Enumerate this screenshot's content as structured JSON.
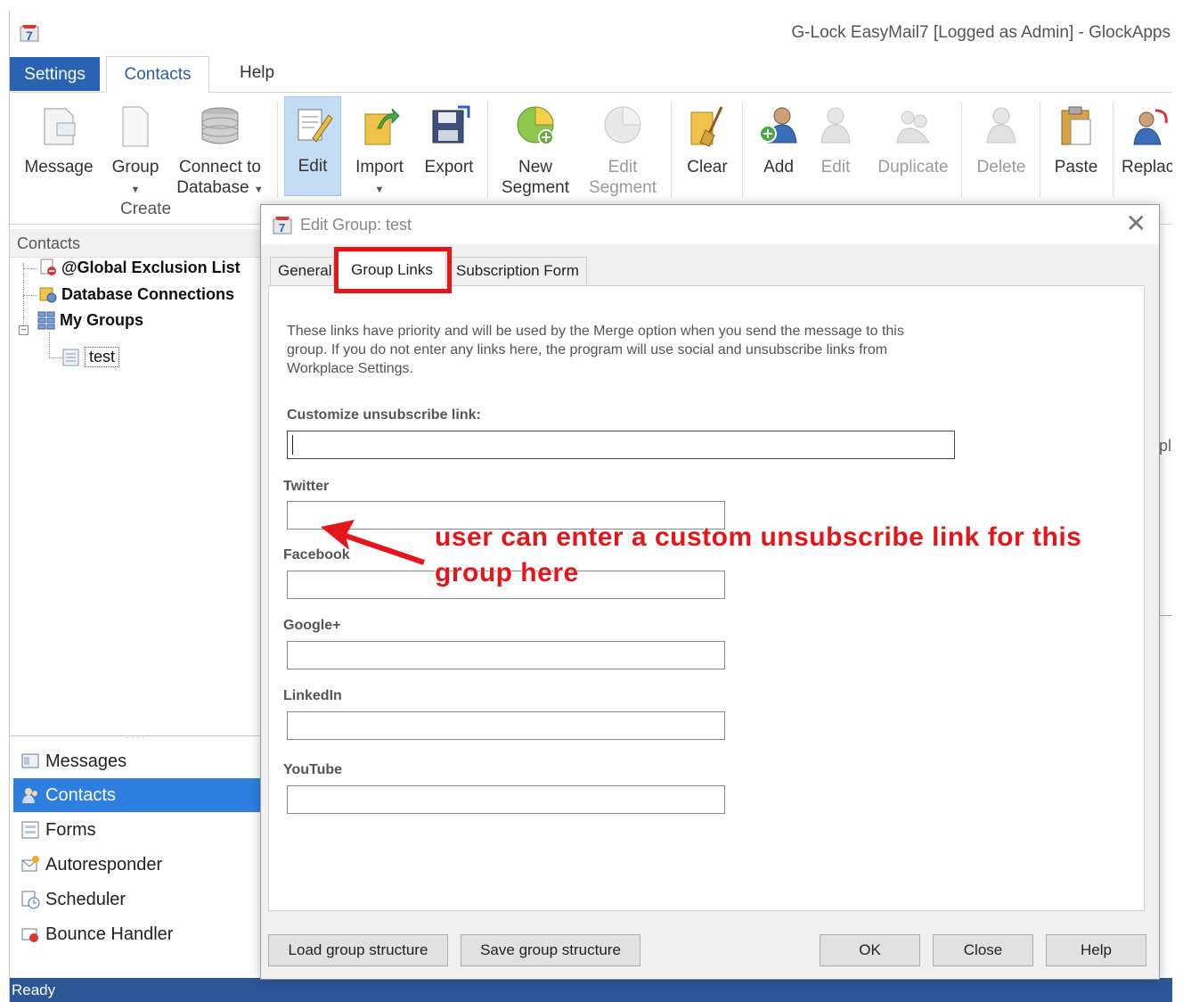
{
  "window": {
    "title": "G-Lock EasyMail7 [Logged as Admin] - GlockApps"
  },
  "ribbon_tabs": {
    "file": "Settings",
    "active": "Contacts",
    "help": "Help"
  },
  "ribbon": {
    "message": "Message",
    "group": "Group",
    "connect_line1": "Connect to",
    "connect_line2": "Database",
    "create_group_label": "Create",
    "edit": "Edit",
    "import": "Import",
    "export": "Export",
    "new_segment_line1": "New",
    "new_segment_line2": "Segment",
    "edit_segment_line1": "Edit",
    "edit_segment_line2": "Segment",
    "clear": "Clear",
    "add": "Add",
    "edit_contact": "Edit",
    "duplicate": "Duplicate",
    "delete": "Delete",
    "paste": "Paste",
    "replace": "Replac"
  },
  "left_panel": {
    "header": "Contacts",
    "tree": {
      "global_exclusion": "@Global Exclusion List",
      "database_connections": "Database Connections",
      "my_groups": "My Groups",
      "test": "test"
    },
    "nav": {
      "messages": "Messages",
      "contacts": "Contacts",
      "forms": "Forms",
      "autoresponder": "Autoresponder",
      "scheduler": "Scheduler",
      "bounce_handler": "Bounce Handler"
    }
  },
  "status": "Ready",
  "background_fragment": "pl",
  "dialog": {
    "title": "Edit Group: test",
    "close_glyph": "✕",
    "tabs": {
      "general": "General",
      "group_links": "Group Links",
      "subscription_form": "Subscription Form"
    },
    "info": "These links have priority and will be used by the Merge option when you send the message to this group. If you do not enter any links here, the program will use social and unsubscribe links from Workplace Settings.",
    "unsubscribe_label": "Customize unsubscribe link:",
    "unsubscribe_value": "",
    "twitter_label": "Twitter",
    "facebook_label": "Facebook",
    "google_label": "Google+",
    "linkedin_label": "LinkedIn",
    "youtube_label": "YouTube",
    "buttons": {
      "load": "Load group structure",
      "save": "Save group structure",
      "ok": "OK",
      "close": "Close",
      "help": "Help"
    }
  },
  "annotation": {
    "text": "user can enter a custom unsubscribe link for this group here",
    "color": "#e3161b"
  },
  "colors": {
    "accent": "#2b63b4",
    "nav_active": "#2f7fe0",
    "status_bar": "#2b5797",
    "highlight": "#e3161b"
  }
}
